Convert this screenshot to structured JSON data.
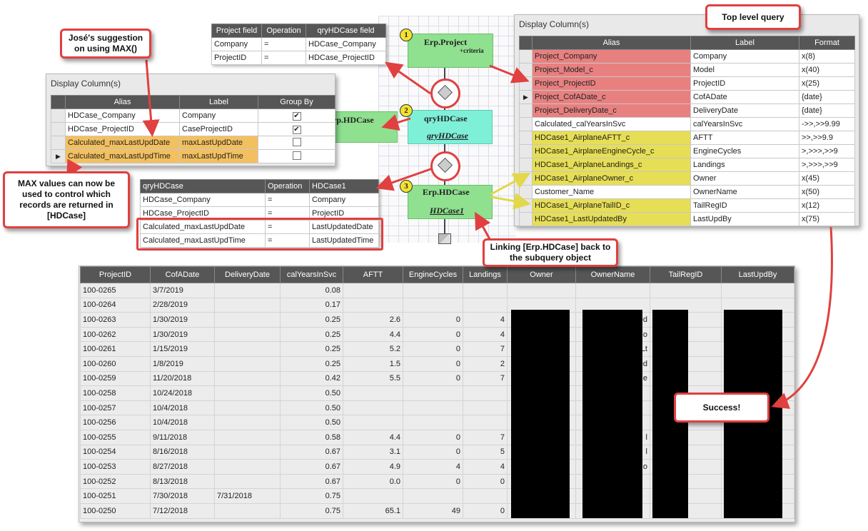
{
  "left_panel": {
    "title": "Display Column(s)",
    "columns": [
      "Alias",
      "Label",
      "Group By"
    ],
    "rows": [
      {
        "alias": "HDCase_Company",
        "label": "Company",
        "checked": true
      },
      {
        "alias": "HDCase_ProjectID",
        "label": "CaseProjectID",
        "checked": true
      },
      {
        "alias": "Calculated_maxLastUpdDate",
        "label": "maxLastUpdDate",
        "checked": false
      },
      {
        "alias": "Calculated_maxLastUpdTime",
        "label": "maxLastUpdTime",
        "checked": false
      }
    ]
  },
  "right_panel": {
    "title": "Display Column(s)",
    "columns": [
      "Alias",
      "Label",
      "Format"
    ],
    "rows": [
      {
        "alias": "Project_Company",
        "label": "Company",
        "format": "x(8)",
        "tone": "red"
      },
      {
        "alias": "Project_Model_c",
        "label": "Model",
        "format": "x(40)",
        "tone": "red"
      },
      {
        "alias": "Project_ProjectID",
        "label": "ProjectID",
        "format": "x(25)",
        "tone": "red"
      },
      {
        "alias": "Project_CofADate_c",
        "label": "CofADate",
        "format": "{date}",
        "tone": "red"
      },
      {
        "alias": "Project_DeliveryDate_c",
        "label": "DeliveryDate",
        "format": "{date}",
        "tone": "red"
      },
      {
        "alias": "Calculated_calYearsInSvc",
        "label": "calYearsInSvc",
        "format": "->>,>>9.99",
        "tone": "none"
      },
      {
        "alias": "HDCase1_AirplaneAFTT_c",
        "label": "AFTT",
        "format": ">>,>>9.9",
        "tone": "yellow"
      },
      {
        "alias": "HDCase1_AirplaneEngineCycle_c",
        "label": "EngineCycles",
        "format": ">,>>>,>>9",
        "tone": "yellow"
      },
      {
        "alias": "HDCase1_AirplaneLandings_c",
        "label": "Landings",
        "format": ">,>>>,>>9",
        "tone": "yellow"
      },
      {
        "alias": "HDCase1_AirplaneOwner_c",
        "label": "Owner",
        "format": "x(45)",
        "tone": "yellow"
      },
      {
        "alias": "Customer_Name",
        "label": "OwnerName",
        "format": "x(50)",
        "tone": "none"
      },
      {
        "alias": "HDCase1_AirplaneTailID_c",
        "label": "TailRegID",
        "format": "x(12)",
        "tone": "yellow"
      },
      {
        "alias": "HDCase1_LastUpdatedBy",
        "label": "LastUpdBy",
        "format": "x(75)",
        "tone": "yellow"
      }
    ]
  },
  "top_join_table": {
    "columns": [
      "Project field",
      "Operation",
      "qryHDCase field"
    ],
    "rows": [
      [
        "Company",
        "=",
        "HDCase_Company"
      ],
      [
        "ProjectID",
        "=",
        "HDCase_ProjectID"
      ]
    ]
  },
  "mid_join_table": {
    "columns": [
      "qryHDCase",
      "Operation",
      "HDCase1"
    ],
    "rows": [
      [
        "HDCase_Company",
        "=",
        "Company"
      ],
      [
        "HDCase_ProjectID",
        "=",
        "ProjectID"
      ],
      [
        "Calculated_maxLastUpdDate",
        "=",
        "LastUpdatedDate"
      ],
      [
        "Calculated_maxLastUpdTime",
        "=",
        "LastUpdatedTime"
      ]
    ]
  },
  "diagram": {
    "node1": {
      "badge": "1",
      "title": "Erp.Project",
      "sub": "+criteria"
    },
    "node2_left": {
      "title": "Erp.HDCase"
    },
    "node2": {
      "badge": "2",
      "title": "qryHDCase",
      "sub": "qryHDCase"
    },
    "node3": {
      "badge": "3",
      "title": "Erp.HDCase",
      "sub": "HDCase1"
    }
  },
  "callouts": {
    "jose": "José's suggestion on using MAX()",
    "max_values": "MAX values can now be used to control which records are returned in [HDCase]",
    "top_level": "Top level query",
    "linking": "Linking [Erp.HDCase] back to the subquery object",
    "success": "Success!"
  },
  "results": {
    "columns": [
      "ProjectID",
      "CofADate",
      "DeliveryDate",
      "calYearsInSvc",
      "AFTT",
      "EngineCycles",
      "Landings",
      "Owner",
      "OwnerName",
      "TailRegID",
      "LastUpdBy"
    ],
    "rows": [
      [
        "100-0265",
        "3/7/2019",
        "",
        "0.08",
        "",
        "",
        "",
        "",
        "",
        "",
        ""
      ],
      [
        "100-0264",
        "2/28/2019",
        "",
        "0.17",
        "",
        "",
        "",
        "",
        "",
        "",
        ""
      ],
      [
        "100-0263",
        "1/30/2019",
        "",
        "0.25",
        "2.6",
        "0",
        "4",
        "",
        "ed",
        "",
        ""
      ],
      [
        "100-0262",
        "1/30/2019",
        "",
        "0.25",
        "4.4",
        "0",
        "4",
        "",
        "o",
        "",
        ""
      ],
      [
        "100-0261",
        "1/15/2019",
        "",
        "0.25",
        "5.2",
        "0",
        "7",
        "",
        "Lt",
        "",
        ""
      ],
      [
        "100-0260",
        "1/8/2019",
        "",
        "0.25",
        "1.5",
        "0",
        "2",
        "",
        "ed",
        "",
        ""
      ],
      [
        "100-0259",
        "11/20/2018",
        "",
        "0.42",
        "5.5",
        "0",
        "7",
        "",
        "e",
        "",
        ""
      ],
      [
        "100-0258",
        "10/24/2018",
        "",
        "0.50",
        "",
        "",
        "",
        "",
        "",
        "",
        ""
      ],
      [
        "100-0257",
        "10/4/2018",
        "",
        "0.50",
        "",
        "",
        "",
        "",
        "",
        "",
        ""
      ],
      [
        "100-0256",
        "10/4/2018",
        "",
        "0.50",
        "",
        "",
        "",
        "",
        "",
        "",
        ""
      ],
      [
        "100-0255",
        "9/11/2018",
        "",
        "0.58",
        "4.4",
        "0",
        "7",
        "",
        "l",
        "",
        ""
      ],
      [
        "100-0254",
        "8/16/2018",
        "",
        "0.67",
        "3.1",
        "0",
        "5",
        "",
        "l",
        "",
        ""
      ],
      [
        "100-0253",
        "8/27/2018",
        "",
        "0.67",
        "4.9",
        "4",
        "4",
        "",
        "o",
        "",
        ""
      ],
      [
        "100-0252",
        "8/13/2018",
        "",
        "0.67",
        "0.0",
        "0",
        "0",
        "",
        "",
        "",
        ""
      ],
      [
        "100-0251",
        "7/30/2018",
        "7/31/2018",
        "0.75",
        "",
        "",
        "",
        "",
        "",
        "",
        ""
      ],
      [
        "100-0250",
        "7/12/2018",
        "",
        "0.75",
        "65.1",
        "49",
        "0",
        "",
        "",
        "",
        ""
      ]
    ]
  }
}
